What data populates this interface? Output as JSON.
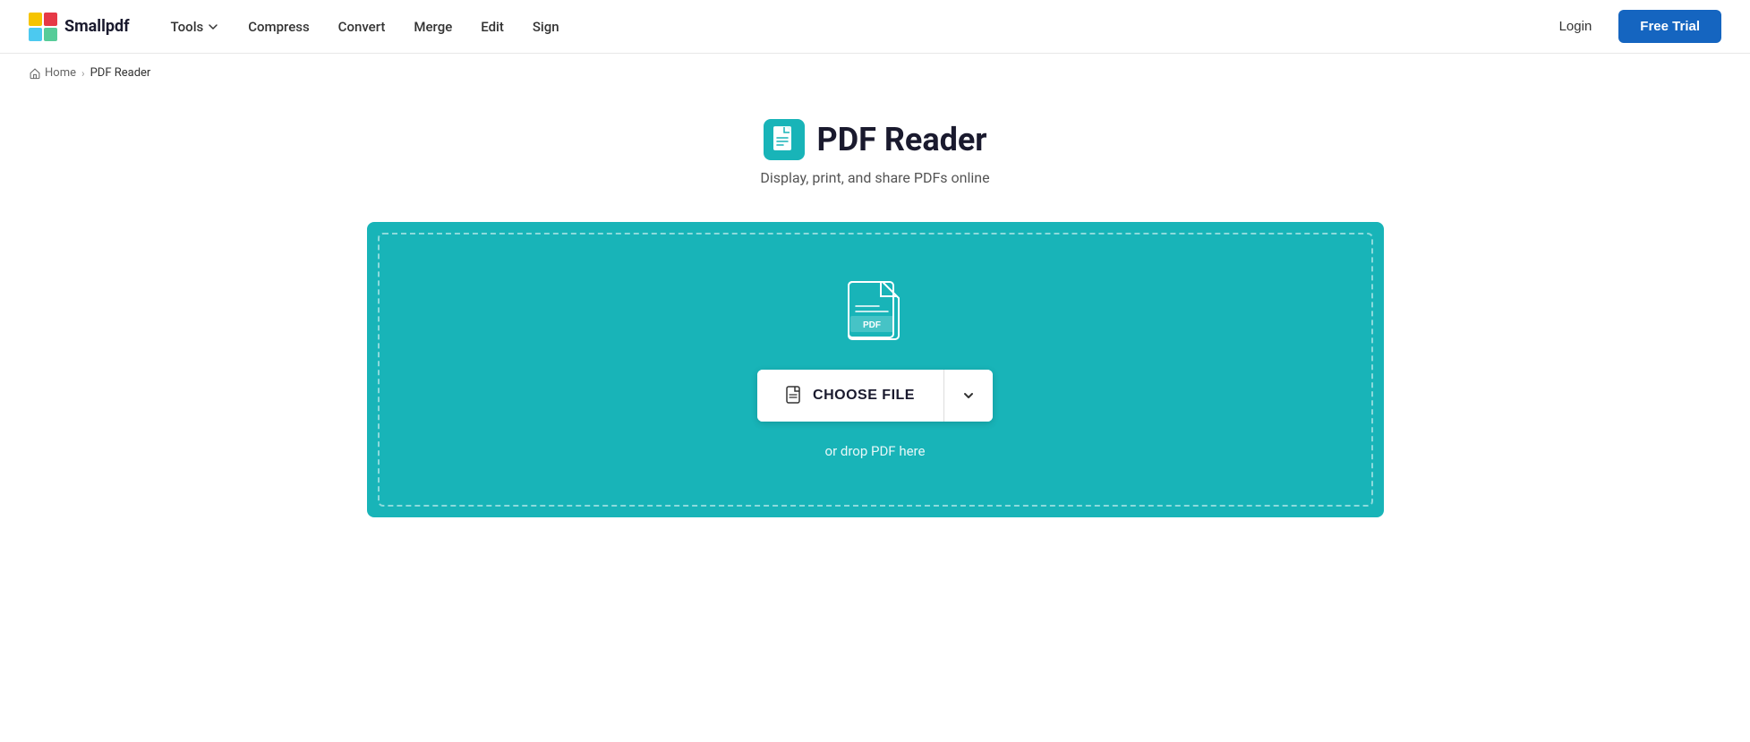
{
  "header": {
    "logo_text": "Smallpdf",
    "nav_items": [
      {
        "label": "Tools",
        "has_dropdown": true
      },
      {
        "label": "Compress"
      },
      {
        "label": "Convert"
      },
      {
        "label": "Merge"
      },
      {
        "label": "Edit"
      },
      {
        "label": "Sign"
      }
    ],
    "login_label": "Login",
    "free_trial_label": "Free Trial"
  },
  "breadcrumb": {
    "home_label": "Home",
    "separator": "›",
    "current_label": "PDF Reader"
  },
  "main": {
    "title": "PDF Reader",
    "subtitle": "Display, print, and share PDFs online",
    "drop_zone": {
      "choose_file_label": "CHOOSE FILE",
      "drop_text": "or drop PDF here"
    }
  }
}
